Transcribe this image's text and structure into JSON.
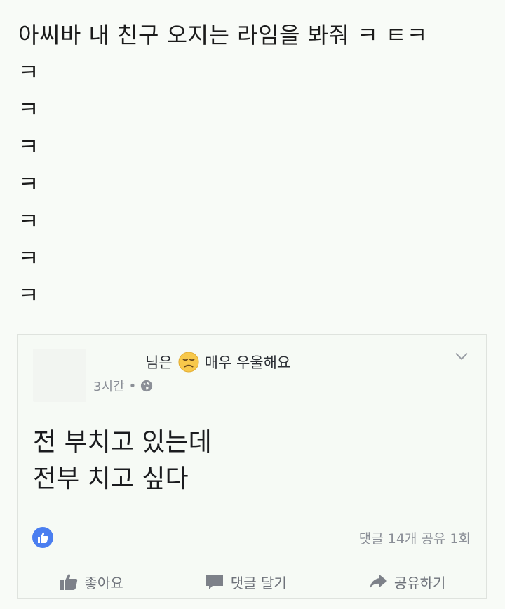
{
  "post": {
    "lines": [
      "아씨바 내 친구 오지는 라임을 봐줘 ㅋ ㅌㅋ",
      "ㅋ",
      "ㅋ",
      "ㅋ",
      "ㅋ",
      "ㅋ",
      "ㅋ",
      "ㅋ"
    ]
  },
  "card": {
    "author_suffix": "님은",
    "feeling_emoji": "disappointed-face-emoji",
    "feeling": "매우 우울해요",
    "time": "3시간",
    "separator": "•",
    "privacy_icon": "globe-icon",
    "menu_icon": "chevron-down-icon",
    "text_lines": [
      "전 부치고 있는데",
      "전부 치고 싶다"
    ],
    "reaction_icon": "like-reaction-icon",
    "reaction_color": "#4a7ef0",
    "stats": "댓글 14개 공유 1회",
    "actions": {
      "like": "좋아요",
      "comment": "댓글 달기",
      "share": "공유하기"
    }
  }
}
